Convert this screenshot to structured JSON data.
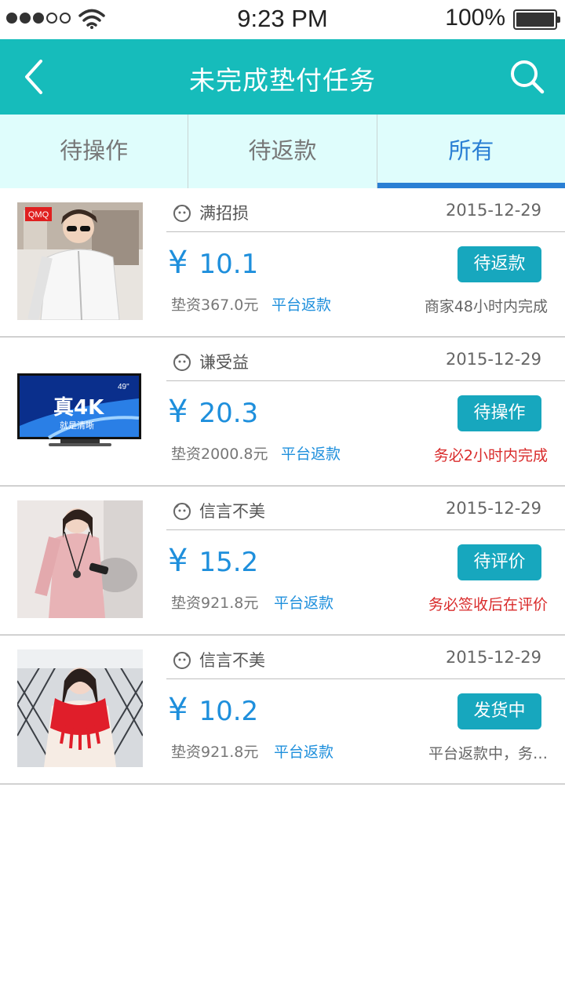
{
  "status_bar": {
    "time": "9:23 PM",
    "battery": "100%",
    "signal_icon": "signal-dots-icon",
    "wifi_icon": "wifi-icon",
    "battery_icon": "battery-icon"
  },
  "nav": {
    "title": "未完成垫付任务",
    "back_icon": "chevron-left-icon",
    "search_icon": "search-icon",
    "bar_color": "#16bcbb"
  },
  "tabs": [
    {
      "label": "待操作",
      "active": false
    },
    {
      "label": "待返款",
      "active": false
    },
    {
      "label": "所有",
      "active": true
    }
  ],
  "accent_color": "#2a7fd4",
  "button_color": "#17a7be",
  "warning_color": "#d92b2b",
  "orders": [
    {
      "image": "white-jacket-model-photo",
      "brand_text": "QMQ",
      "shop": "满招损",
      "date": "2015-12-29",
      "currency": "¥",
      "price": "10.1",
      "advance": "垫资367.0元",
      "refund": "平台返款",
      "status": "待返款",
      "note": "商家48小时内完成",
      "note_style": "normal"
    },
    {
      "image": "4k-tv-product-photo",
      "tv_text": "真4K",
      "tv_subtext": "就是清晰",
      "tv_size": "49\"",
      "shop": "谦受益",
      "date": "2015-12-29",
      "currency": "¥",
      "price": "20.3",
      "advance": "垫资2000.8元",
      "refund": "平台返款",
      "status": "待操作",
      "note": "务必2小时内完成",
      "note_style": "warn"
    },
    {
      "image": "pink-sweater-model-photo",
      "shop": "信言不美",
      "date": "2015-12-29",
      "currency": "¥",
      "price": "15.2",
      "advance": "垫资921.8元",
      "refund": "平台返款",
      "status": "待评价",
      "note": "务必签收后在评价",
      "note_style": "warn"
    },
    {
      "image": "red-scarf-model-photo",
      "shop": "信言不美",
      "date": "2015-12-29",
      "currency": "¥",
      "price": "10.2",
      "advance": "垫资921.8元",
      "refund": "平台返款",
      "status": "发货中",
      "note": "平台返款中，务…",
      "note_style": "normal"
    }
  ]
}
